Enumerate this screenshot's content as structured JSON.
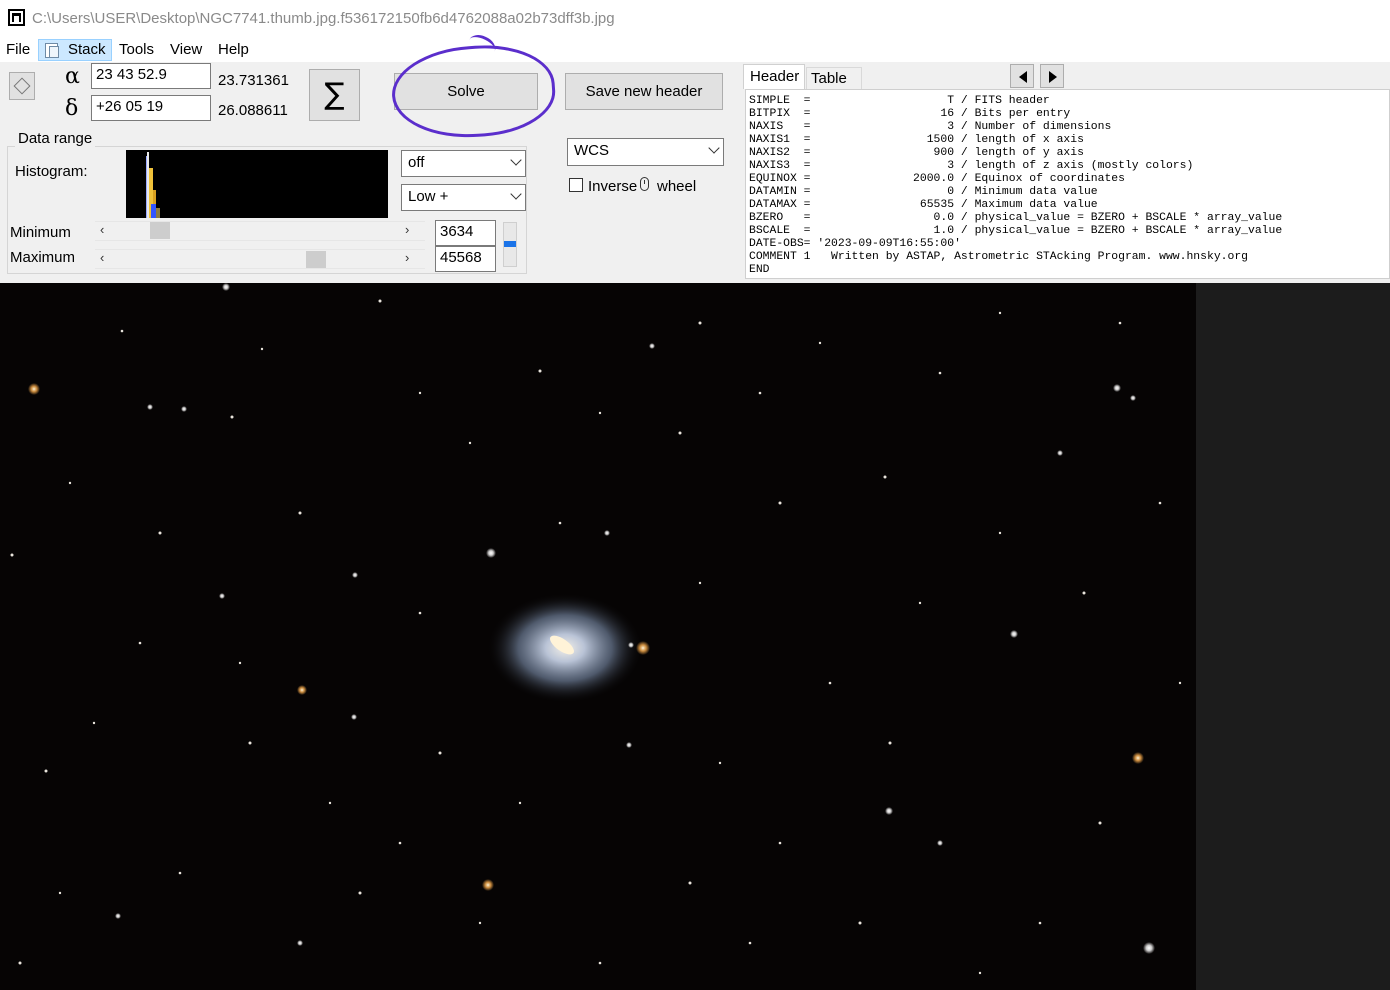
{
  "window": {
    "title": "C:\\Users\\USER\\Desktop\\NGC7741.thumb.jpg.f536172150fb6d4762088a02b73dff3b.jpg"
  },
  "menu": {
    "items": [
      "File",
      "Stack",
      "Tools",
      "View",
      "Help"
    ]
  },
  "coords": {
    "alpha_symbol": "α",
    "delta_symbol": "δ",
    "ra_input": "23 43 52.9",
    "dec_input": "+26 05 19",
    "ra_decimal": "23.731361",
    "dec_decimal": "26.088611",
    "sum_symbol": "∑"
  },
  "buttons": {
    "solve": "Solve",
    "save_header": "Save new header"
  },
  "data_range": {
    "title": "Data range",
    "histogram_label": "Histogram:",
    "minimum_label": "Minimum",
    "maximum_label": "Maximum",
    "minimum_value": "3634",
    "maximum_value": "45568",
    "minimum_slider_fraction": 0.12,
    "maximum_slider_fraction": 0.66,
    "stretch_select": "off",
    "range_select": "Low +",
    "scroll_left": "‹",
    "scroll_right": "›"
  },
  "wcs": {
    "select": "WCS",
    "inverse_label": "Inverse",
    "wheel_label": "wheel",
    "inverse_checked": false
  },
  "tabs": {
    "header": "Header",
    "table": "Table"
  },
  "fits_header": [
    "SIMPLE  =                    T / FITS header",
    "BITPIX  =                   16 / Bits per entry",
    "NAXIS   =                    3 / Number of dimensions",
    "NAXIS1  =                 1500 / length of x axis",
    "NAXIS2  =                  900 / length of y axis",
    "NAXIS3  =                    3 / length of z axis (mostly colors)",
    "EQUINOX =               2000.0 / Equinox of coordinates",
    "DATAMIN =                    0 / Minimum data value",
    "DATAMAX =                65535 / Maximum data value",
    "BZERO   =                  0.0 / physical_value = BZERO + BSCALE * array_value",
    "BSCALE  =                  1.0 / physical_value = BZERO + BSCALE * array_value",
    "DATE-OBS= '2023-09-09T16:55:00'",
    "COMMENT 1   Written by ASTAP, Astrometric STAcking Program. www.hnsky.org",
    "END"
  ],
  "colors": {
    "annotation_circle": "#5b2ecc",
    "slider_accent": "#1a73e8",
    "sky": "#060404"
  }
}
